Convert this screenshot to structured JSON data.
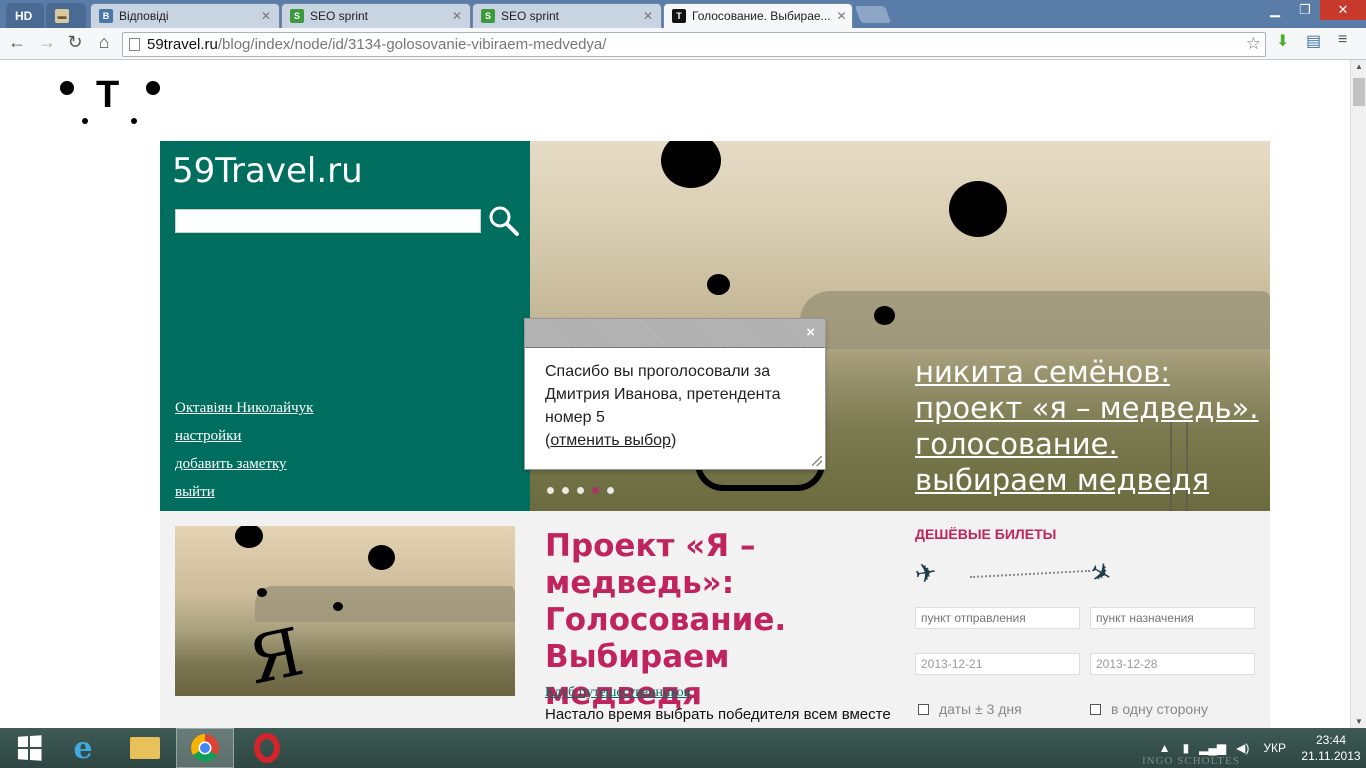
{
  "browser": {
    "tabs": [
      {
        "label": "HD",
        "favicon": "hd-icon"
      },
      {
        "label": "",
        "favicon": "book-icon"
      },
      {
        "label": "Відповіді",
        "favicon": "vk-icon",
        "favicon_text": "В"
      },
      {
        "label": "SEO sprint",
        "favicon": "seo-icon",
        "favicon_text": "S"
      },
      {
        "label": "SEO sprint",
        "favicon": "seo-icon",
        "favicon_text": "S"
      },
      {
        "label": "Голосование. Выбирае...",
        "favicon": "t-icon",
        "favicon_text": "T",
        "active": true
      }
    ],
    "url_domain": "59travel.ru",
    "url_path": "/blog/index/node/id/3134-golosovanie-vibiraem-medvedya/",
    "accent": "#5a7ca8"
  },
  "site": {
    "logo_letter": "T",
    "title": "59Travel.ru",
    "search_placeholder": "",
    "user_links": [
      "Октавіян Николайчук",
      "настройки",
      "добавить заметку",
      "выйти"
    ],
    "brand_color": "#006e5f",
    "accent_color": "#c0245e"
  },
  "hero": {
    "title": "никита семёнов: проект «я – медведь». голосование. выбираем медведя",
    "slides_total": 5,
    "slide_active": 4
  },
  "popup": {
    "message": "Спасибо вы проголосовали за Дмитрия Иванова, претендента номер 5",
    "cancel_link": "отменить выбор",
    "paren_open": "(",
    "paren_close": ")",
    "close_glyph": "×"
  },
  "article": {
    "title": "Проект «Я – медведь»: Голосование. Выбираем медведя",
    "category": "Клуб путешественников",
    "excerpt": "Настало время выбрать победителя всем вместе"
  },
  "tickets": {
    "heading": "ДЕШЁВЫЕ БИЛЕТЫ",
    "from_placeholder": "пункт отправления",
    "to_placeholder": "пункт назначения",
    "date_from": "2013-12-21",
    "date_to": "2013-12-28",
    "option_dates": "даты ± 3 дня",
    "option_oneway": "в одну сторону"
  },
  "taskbar": {
    "language": "УКР",
    "time": "23:44",
    "date": "21.11.2013",
    "watermark": "INGO SCHOLTES"
  }
}
